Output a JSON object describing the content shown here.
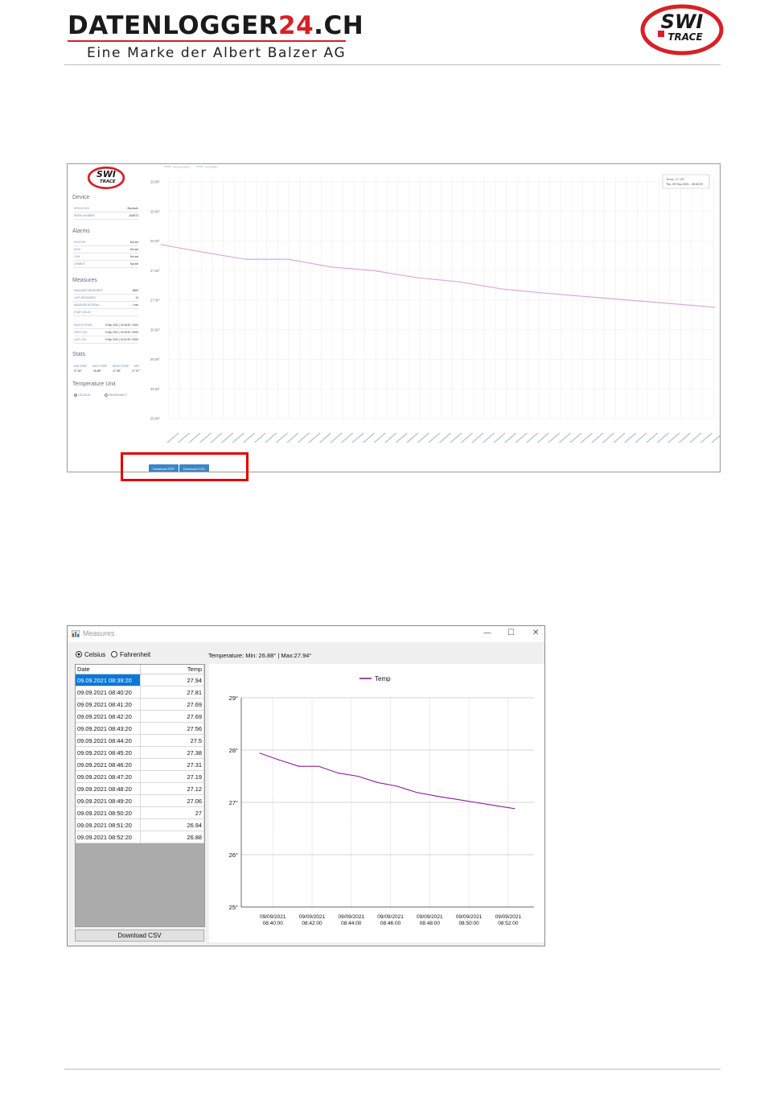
{
  "header": {
    "brand_main": "DATENLOGGER",
    "brand_accent": "24",
    "brand_tld": ".CH",
    "brand_sub": "Eine Marke der Albert Balzer AG",
    "logo_text_top": "SWI",
    "logo_text_bottom": "TRACE",
    "brand_red": "#d91f26"
  },
  "web_dashboard": {
    "legend": [
      "Temperature",
      "Humidity"
    ],
    "tooltip_line1": "Temp: 27.94°",
    "tooltip_line2": "Thu, 09 Sep 2021 - 08:40:20",
    "sections": {
      "device": {
        "title": "Device",
        "rows": [
          {
            "label": "DEVICE LED",
            "value": "Bluetooth"
          },
          {
            "label": "SERIAL NUMBER",
            "value": "AD0073"
          }
        ]
      },
      "alarms": {
        "title": "Alarms",
        "rows": [
          {
            "label": "HIGHTOP",
            "value": "Not set"
          },
          {
            "label": "HIGH",
            "value": "Not set"
          },
          {
            "label": "LOW",
            "value": "Not set"
          },
          {
            "label": "LOWBOT",
            "value": "Not set"
          }
        ]
      },
      "measures": {
        "title": "Measures",
        "rows": [
          {
            "label": "AVAILABLE MEASURES",
            "value": "8609"
          },
          {
            "label": "LAST MEASURES",
            "value": "14"
          },
          {
            "label": "MEASURE INTERVAL",
            "value": "1 min"
          },
          {
            "label": "START DELAY",
            "value": ""
          },
          {
            "label": "DEVICE START",
            "value": "9 Sep 2021 | 10:39:20 +0200"
          },
          {
            "label": "FIRST LOG",
            "value": "9 Sep 2021 | 10:39:20 +0200"
          },
          {
            "label": "LAST LOG",
            "value": "9 Sep 2021 | 10:52:20 +0200"
          }
        ]
      },
      "stats": {
        "title": "Stats",
        "headers": [
          "MIN TEMP",
          "MAX TEMP",
          "MEAN TEMP",
          "MKT"
        ],
        "values": [
          "27.94°",
          "26.88°",
          "27.38°",
          "27.37°"
        ]
      },
      "unit": {
        "title": "Temperature Unit",
        "options": [
          "CELSIUS",
          "FAHRENHEIT"
        ]
      }
    },
    "buttons": {
      "pdf": "Download PDF",
      "csv": "Download CSV"
    }
  },
  "desktop_app": {
    "window_title": "Measures",
    "controls": {
      "minimize": "—",
      "maximize": "☐",
      "close": "✕"
    },
    "radio_celsius": "Celsius",
    "radio_fahrenheit": "Fahrenheit",
    "stats_text": "Temperature: Min: 26.88° | Max:27.94°",
    "table": {
      "col_date": "Date",
      "col_temp": "Temp",
      "rows": [
        {
          "date": "09.09.2021 08:39:20",
          "temp": "27.94"
        },
        {
          "date": "09.09.2021 08:40:20",
          "temp": "27.81"
        },
        {
          "date": "09.09.2021 08:41:20",
          "temp": "27.69"
        },
        {
          "date": "09.09.2021 08:42:20",
          "temp": "27.69"
        },
        {
          "date": "09.09.2021 08:43:20",
          "temp": "27.56"
        },
        {
          "date": "09.09.2021 08:44:20",
          "temp": "27.5"
        },
        {
          "date": "09.09.2021 08:45:20",
          "temp": "27.38"
        },
        {
          "date": "09.09.2021 08:46:20",
          "temp": "27.31"
        },
        {
          "date": "09.09.2021 08:47:20",
          "temp": "27.19"
        },
        {
          "date": "09.09.2021 08:48:20",
          "temp": "27.12"
        },
        {
          "date": "09.09.2021 08:49:20",
          "temp": "27.06"
        },
        {
          "date": "09.09.2021 08:50:20",
          "temp": "27"
        },
        {
          "date": "09.09.2021 08:51:20",
          "temp": "26.94"
        },
        {
          "date": "09.09.2021 08:52:20",
          "temp": "26.88"
        }
      ]
    },
    "download_label": "Download CSV",
    "line_color": "#8b1a9a"
  },
  "chart_data": [
    {
      "type": "line",
      "x": [
        "09.09.2021 08:39:20",
        "09.09.2021 08:40:20",
        "09.09.2021 08:41:20",
        "09.09.2021 08:42:20",
        "09.09.2021 08:43:20",
        "09.09.2021 08:44:20",
        "09.09.2021 08:45:20",
        "09.09.2021 08:46:20",
        "09.09.2021 08:47:20",
        "09.09.2021 08:48:20",
        "09.09.2021 08:49:20",
        "09.09.2021 08:50:20",
        "09.09.2021 08:51:20",
        "09.09.2021 08:52:20"
      ],
      "series": [
        {
          "name": "Temperature",
          "values": [
            27.94,
            27.81,
            27.69,
            27.69,
            27.56,
            27.5,
            27.38,
            27.31,
            27.19,
            27.12,
            27.06,
            27,
            26.94,
            26.88
          ]
        }
      ],
      "yticks": [
        "25.00°",
        "25.50°",
        "26.00°",
        "26.50°",
        "27.00°",
        "27.50°",
        "28.00°",
        "28.50°",
        "29.00°"
      ],
      "ylim": [
        25,
        29
      ],
      "grid": true,
      "legend": "top-left"
    },
    {
      "type": "line",
      "x": [
        "09/09/2021 08:39:20",
        "09/09/2021 08:40:20",
        "09/09/2021 08:41:20",
        "09/09/2021 08:42:20",
        "09/09/2021 08:43:20",
        "09/09/2021 08:44:20",
        "09/09/2021 08:45:20",
        "09/09/2021 08:46:20",
        "09/09/2021 08:47:20",
        "09/09/2021 08:48:20",
        "09/09/2021 08:49:20",
        "09/09/2021 08:50:20",
        "09/09/2021 08:51:20",
        "09/09/2021 08:52:20"
      ],
      "series": [
        {
          "name": "Temp",
          "values": [
            27.94,
            27.81,
            27.69,
            27.69,
            27.56,
            27.5,
            27.38,
            27.31,
            27.19,
            27.12,
            27.06,
            27,
            26.94,
            26.88
          ]
        }
      ],
      "xticks": [
        {
          "line1": "09/09/2021",
          "line2": "08:40:00"
        },
        {
          "line1": "09/09/2021",
          "line2": "08:42:00"
        },
        {
          "line1": "09/09/2021",
          "line2": "08:44:00"
        },
        {
          "line1": "09/09/2021",
          "line2": "08:46:00"
        },
        {
          "line1": "09/09/2021",
          "line2": "08:48:00"
        },
        {
          "line1": "09/09/2021",
          "line2": "08:50:00"
        },
        {
          "line1": "09/09/2021",
          "line2": "08:52:00"
        }
      ],
      "yticks": [
        "25°",
        "26°",
        "27°",
        "28°",
        "29°"
      ],
      "ylim": [
        25,
        29
      ],
      "grid": true,
      "legend": "top-center"
    }
  ]
}
